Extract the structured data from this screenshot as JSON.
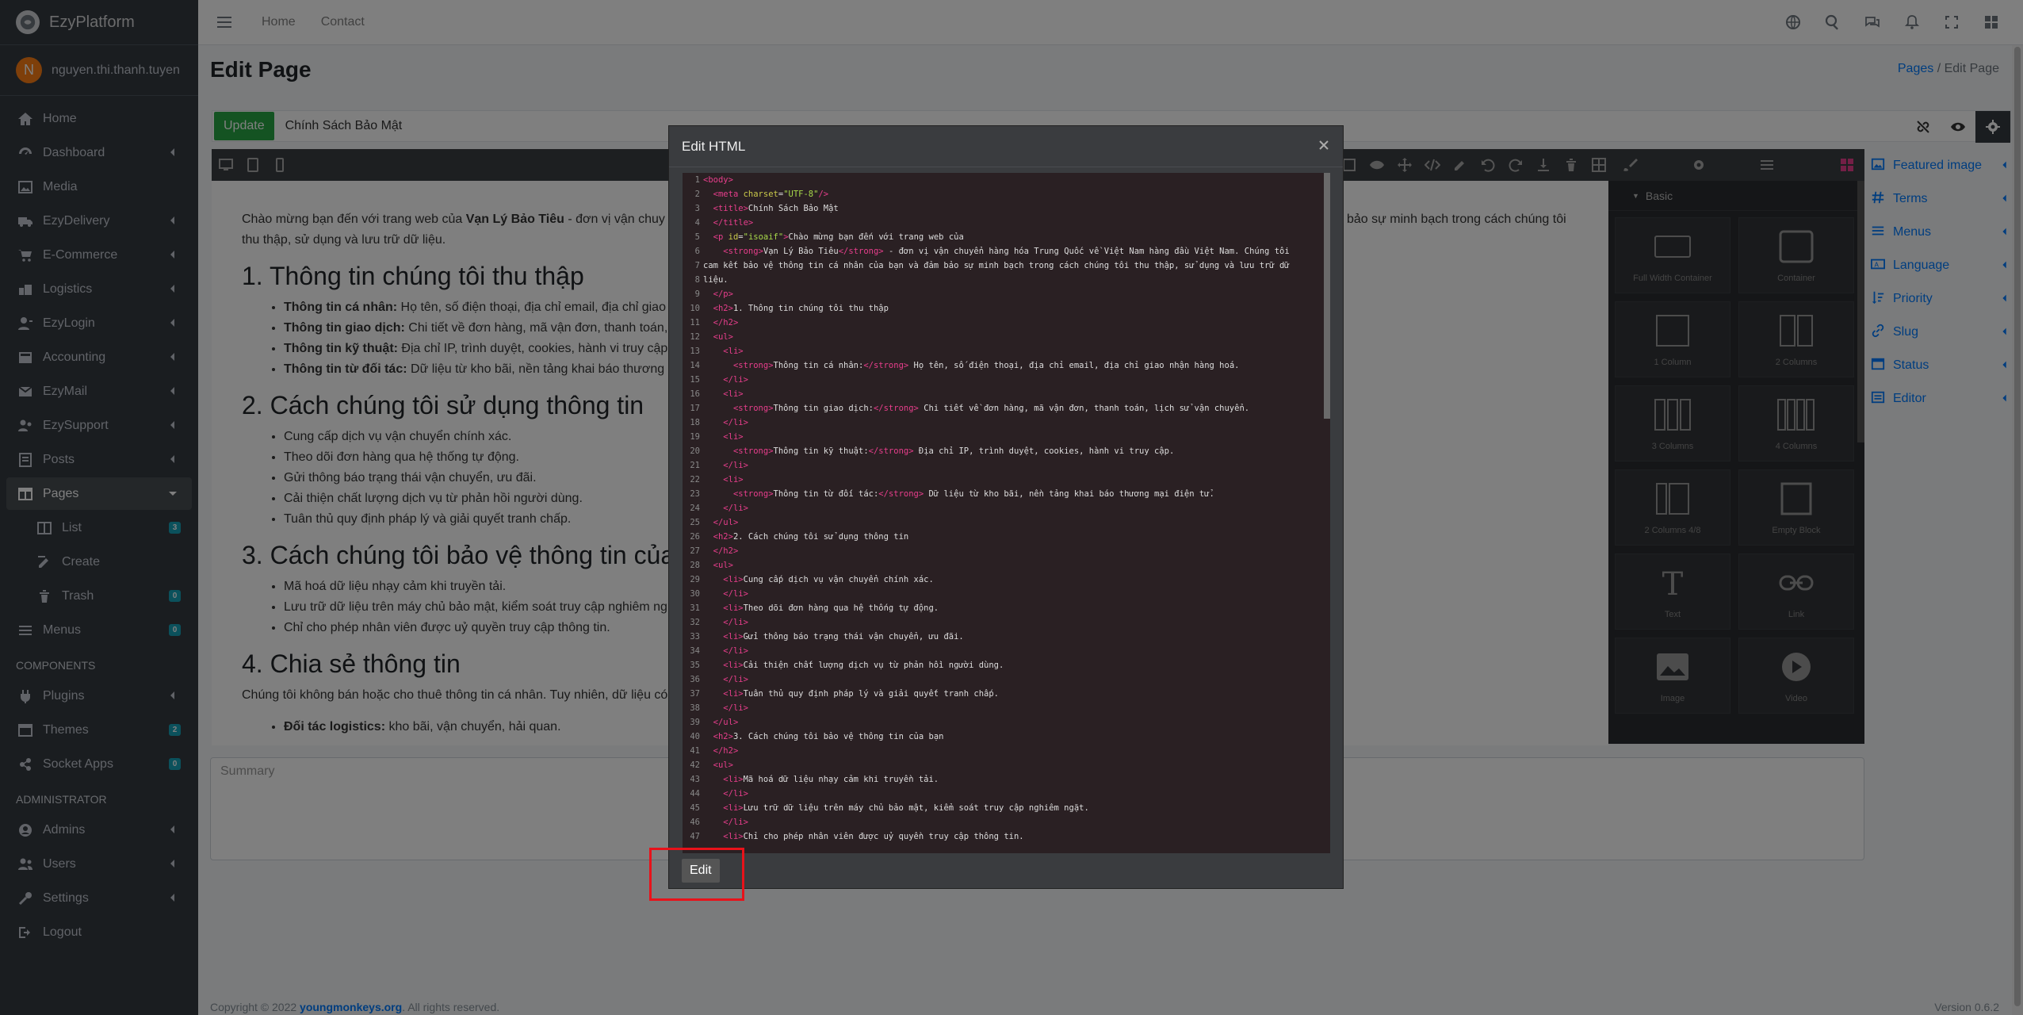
{
  "brand": {
    "name": "EzyPlatform"
  },
  "user": {
    "initial": "N",
    "name": "nguyen.thi.thanh.tuyen"
  },
  "sidebar": {
    "items": [
      {
        "label": "Home",
        "icon": "home-icon"
      },
      {
        "label": "Dashboard",
        "icon": "dashboard-icon"
      },
      {
        "label": "Media",
        "icon": "media-icon"
      },
      {
        "label": "EzyDelivery",
        "icon": "truck-icon"
      },
      {
        "label": "E-Commerce",
        "icon": "cart-icon"
      },
      {
        "label": "Logistics",
        "icon": "logistics-icon"
      },
      {
        "label": "EzyLogin",
        "icon": "user-login-icon"
      },
      {
        "label": "Accounting",
        "icon": "accounting-icon"
      },
      {
        "label": "EzyMail",
        "icon": "mail-icon"
      },
      {
        "label": "EzySupport",
        "icon": "support-icon"
      },
      {
        "label": "Posts",
        "icon": "posts-icon"
      },
      {
        "label": "Pages",
        "icon": "pages-icon"
      },
      {
        "label": "List",
        "icon": "list-icon",
        "badge": "3"
      },
      {
        "label": "Create",
        "icon": "create-icon"
      },
      {
        "label": "Trash",
        "icon": "trash-icon",
        "badge": "0"
      },
      {
        "label": "Menus",
        "icon": "menus-icon",
        "badge": "0"
      }
    ],
    "components_header": "COMPONENTS",
    "components": [
      {
        "label": "Plugins",
        "icon": "plugin-icon"
      },
      {
        "label": "Themes",
        "icon": "themes-icon",
        "badge": "2"
      },
      {
        "label": "Socket Apps",
        "icon": "socket-icon",
        "badge": "0"
      }
    ],
    "admin_header": "ADMINISTRATOR",
    "admin": [
      {
        "label": "Admins",
        "icon": "admin-icon"
      },
      {
        "label": "Users",
        "icon": "users-icon"
      },
      {
        "label": "Settings",
        "icon": "settings-icon"
      },
      {
        "label": "Logout",
        "icon": "logout-icon"
      }
    ]
  },
  "topbar": {
    "home": "Home",
    "contact": "Contact"
  },
  "page": {
    "title": "Edit Page",
    "breadcrumb_link": "Pages",
    "breadcrumb_sep": "/",
    "breadcrumb_current": "Edit Page",
    "update_label": "Update",
    "page_name": "Chính Sách Bảo Mật",
    "summary_placeholder": "Summary"
  },
  "canvas": {
    "intro_pre": "Chào mừng bạn đến với trang web của ",
    "intro_strong": "Vạn Lý Bảo Tiêu",
    "intro_post": " - đơn vị vận chuy",
    "intro_right": "bảo sự minh bạch trong cách chúng tôi",
    "intro_line2": "thu thập, sử dụng và lưu trữ dữ liệu.",
    "h1": "1. Thông tin chúng tôi thu thập",
    "list1": [
      {
        "strong": "Thông tin cá nhân:",
        "text": " Họ tên, số điện thoại, địa chỉ email, địa chỉ giao"
      },
      {
        "strong": "Thông tin giao dịch:",
        "text": " Chi tiết về đơn hàng, mã vận đơn, thanh toán,"
      },
      {
        "strong": "Thông tin kỹ thuật:",
        "text": " Địa chỉ IP, trình duyệt, cookies, hành vi truy cập"
      },
      {
        "strong": "Thông tin từ đối tác:",
        "text": " Dữ liệu từ kho bãi, nền tảng khai báo thương"
      }
    ],
    "h2": "2. Cách chúng tôi sử dụng thông tin",
    "list2": [
      "Cung cấp dịch vụ vận chuyển chính xác.",
      "Theo dõi đơn hàng qua hệ thống tự động.",
      "Gửi thông báo trạng thái vận chuyển, ưu đãi.",
      "Cải thiện chất lượng dịch vụ từ phản hồi người dùng.",
      "Tuân thủ quy định pháp lý và giải quyết tranh chấp."
    ],
    "h3": "3. Cách chúng tôi bảo vệ thông tin của",
    "list3": [
      "Mã hoá dữ liệu nhạy cảm khi truyền tải.",
      "Lưu trữ dữ liệu trên máy chủ bảo mật, kiểm soát truy cập nghiêm ng",
      "Chỉ cho phép nhân viên được uỷ quyền truy cập thông tin."
    ],
    "h4": "4. Chia sẻ thông tin",
    "p4": "Chúng tôi không bán hoặc cho thuê thông tin cá nhân. Tuy nhiên, dữ liệu có",
    "list4": [
      {
        "strong": "Đối tác logistics:",
        "text": " kho bãi, vận chuyển, hải quan."
      }
    ]
  },
  "blocks": {
    "header": "Basic",
    "items": [
      "Full Width Container",
      "Container",
      "1 Column",
      "2 Columns",
      "3 Columns",
      "4 Columns",
      "2 Columns 4/8",
      "Empty Block",
      "Text",
      "Link",
      "Image",
      "Video"
    ]
  },
  "right_panel": [
    {
      "label": "Featured image",
      "icon": "image-icon"
    },
    {
      "label": "Terms",
      "icon": "hashtag-icon"
    },
    {
      "label": "Menus",
      "icon": "menu-icon"
    },
    {
      "label": "Language",
      "icon": "language-icon"
    },
    {
      "label": "Priority",
      "icon": "priority-icon"
    },
    {
      "label": "Slug",
      "icon": "link-icon"
    },
    {
      "label": "Status",
      "icon": "status-icon"
    },
    {
      "label": "Editor",
      "icon": "editor-icon"
    }
  ],
  "footer": {
    "left_pre": "Copyright © 2022 ",
    "left_link": "youngmonkeys.org",
    "left_post": ". All rights reserved.",
    "right": "Version 0.6.2"
  },
  "modal": {
    "title": "Edit HTML",
    "edit_label": "Edit",
    "code": [
      "<body>",
      "  <meta charset=\"UTF-8\"/>",
      "  <title>Chính Sách Bảo Mật",
      "  </title>",
      "  <p id=\"isoaif\">Chào mừng bạn đến với trang web của",
      "    <strong>Vạn Lý Bảo Tiêu</strong> - đơn vị vận chuyển hàng hóa Trung Quốc về Việt Nam hàng đầu Việt Nam. Chúng tôi",
      "cam kết bảo vệ thông tin cá nhân của bạn và đảm bảo sự minh bạch trong cách chúng tôi thu thập, sử dụng và lưu trữ dữ",
      "liệu.",
      "  </p>",
      "  <h2>1. Thông tin chúng tôi thu thập",
      "  </h2>",
      "  <ul>",
      "    <li>",
      "      <strong>Thông tin cá nhân:</strong> Họ tên, số điện thoại, địa chỉ email, địa chỉ giao nhận hàng hoá.",
      "    </li>",
      "    <li>",
      "      <strong>Thông tin giao dịch:</strong> Chi tiết về đơn hàng, mã vận đơn, thanh toán, lịch sử vận chuyển.",
      "    </li>",
      "    <li>",
      "      <strong>Thông tin kỹ thuật:</strong> Địa chỉ IP, trình duyệt, cookies, hành vi truy cập.",
      "    </li>",
      "    <li>",
      "      <strong>Thông tin từ đối tác:</strong> Dữ liệu từ kho bãi, nền tảng khai báo thương mại điện tử.",
      "    </li>",
      "  </ul>",
      "  <h2>2. Cách chúng tôi sử dụng thông tin",
      "  </h2>",
      "  <ul>",
      "    <li>Cung cấp dịch vụ vận chuyển chính xác.",
      "    </li>",
      "    <li>Theo dõi đơn hàng qua hệ thống tự động.",
      "    </li>",
      "    <li>Gửi thông báo trạng thái vận chuyển, ưu đãi.",
      "    </li>",
      "    <li>Cải thiện chất lượng dịch vụ từ phản hồi người dùng.",
      "    </li>",
      "    <li>Tuân thủ quy định pháp lý và giải quyết tranh chấp.",
      "    </li>",
      "  </ul>",
      "  <h2>3. Cách chúng tôi bảo vệ thông tin của bạn",
      "  </h2>",
      "  <ul>",
      "    <li>Mã hoá dữ liệu nhạy cảm khi truyền tải.",
      "    </li>",
      "    <li>Lưu trữ dữ liệu trên máy chủ bảo mật, kiểm soát truy cập nghiêm ngặt.",
      "    </li>",
      "    <li>Chỉ cho phép nhân viên được uỷ quyền truy cập thông tin."
    ]
  }
}
